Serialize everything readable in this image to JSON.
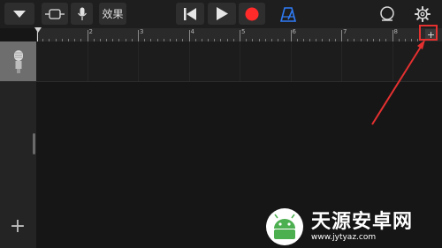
{
  "toolbar": {
    "effects_label": "效果",
    "icons": [
      "chevron-down-icon",
      "track-view-icon",
      "microphone-icon",
      "rewind-icon",
      "play-icon",
      "record-icon",
      "metronome-icon",
      "loop-icon",
      "gear-icon"
    ],
    "record_color": "#ff2a2a",
    "metronome_color": "#2f7bf5"
  },
  "ruler": {
    "bar_numbers": [
      "2",
      "3",
      "4",
      "5",
      "6",
      "7",
      "8"
    ],
    "add_section_label": "+"
  },
  "tracks": [
    {
      "instrument_icon": "microphone-icon"
    }
  ],
  "sidebar": {
    "add_track_label": "+"
  },
  "annotation": {
    "color": "#e53030"
  },
  "watermark": {
    "brand": "天源安卓网",
    "url": "www.jytyaz.com",
    "logo_color": "#4caf50"
  }
}
